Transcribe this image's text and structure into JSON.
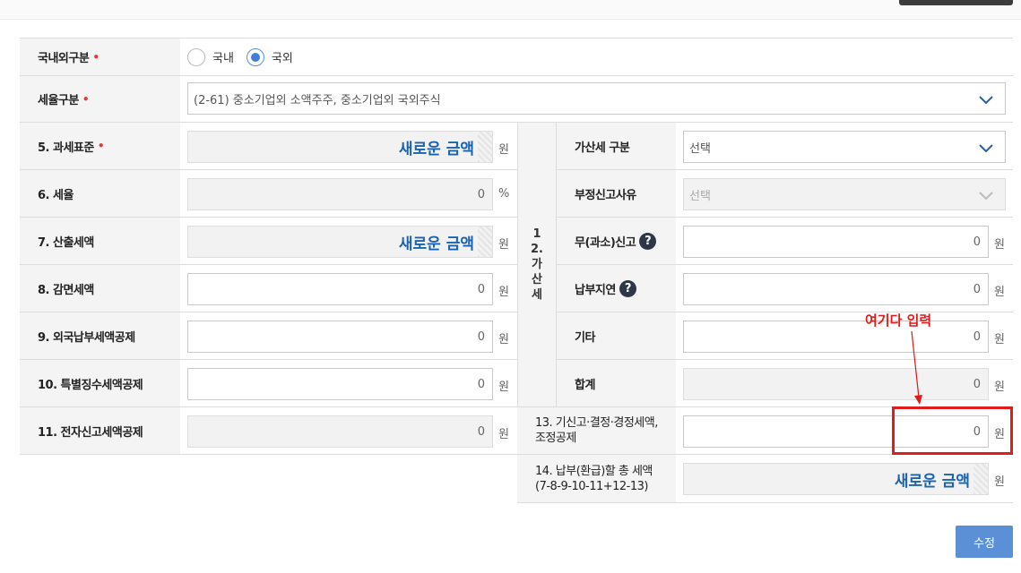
{
  "units": {
    "won": "원",
    "percent": "%"
  },
  "new_amount": "새로운 금액",
  "region": {
    "label": "국내외구분",
    "options": [
      "국내",
      "국외"
    ],
    "selected": 1
  },
  "tax_rate_type": {
    "label": "세율구분",
    "value": "(2-61) 중소기업외 소액주주, 중소기업외 국외주식"
  },
  "rows": {
    "base": {
      "label": "5. 과세표준"
    },
    "rate": {
      "label": "6. 세율",
      "value": "0"
    },
    "calc": {
      "label": "7. 산출세액"
    },
    "reduction": {
      "label": "8. 감면세액",
      "value": "0"
    },
    "foreign_credit": {
      "label": "9. 외국납부세액공제",
      "value": "0"
    },
    "special_credit": {
      "label": "10. 특별징수세액공제",
      "value": "0"
    },
    "e_filing_credit": {
      "label": "11. 전자신고세액공제",
      "value": "0"
    }
  },
  "penalty": {
    "section_label": "12. 가산세",
    "type": {
      "label": "가산세 구분",
      "value": "선택"
    },
    "reason": {
      "label": "부정신고사유",
      "value": "선택"
    },
    "under_report": {
      "label": "무(과소)신고",
      "value": "0"
    },
    "late_payment": {
      "label": "납부지연",
      "value": "0"
    },
    "other": {
      "label": "기타",
      "value": "0"
    },
    "total": {
      "label": "합계",
      "value": "0"
    }
  },
  "adjust": {
    "label_line1": "13. 기신고·결정·경정세액,",
    "label_line2": "조정공제",
    "value": "0"
  },
  "total_pay": {
    "label_line1": "14. 납부(환급)할 총 세액",
    "label_line2": "(7-8-9-10-11+12-13)"
  },
  "annotation": "여기다 입력",
  "submit_label": "수정",
  "colors": {
    "accent": "#5b8fd6",
    "new_amount": "#1a63b0",
    "annotation": "#e01b1b"
  }
}
